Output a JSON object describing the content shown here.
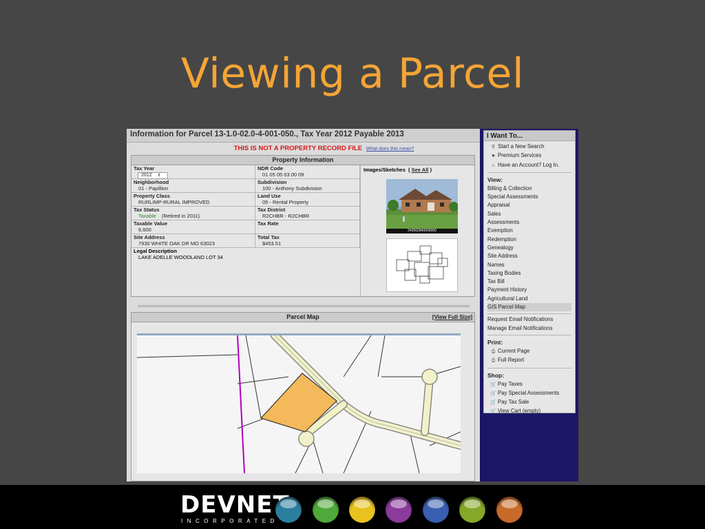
{
  "slide": {
    "title": "Viewing a Parcel"
  },
  "parcel": {
    "header": "Information for Parcel 13-1.0-02.0-4-001-050., Tax Year 2012 Payable 2013",
    "notice": "THIS IS NOT A PROPERTY RECORD FILE",
    "notice_link": "What does this mean?",
    "property_info_title": "Property Information",
    "fields": {
      "tax_year_label": "Tax Year",
      "tax_year_value": "2012",
      "ndr_code_label": "NDR Code",
      "ndr_code_value": "01 05 05 03 00 09",
      "neighborhood_label": "Neighborhood",
      "neighborhood_value": "01 - Papillion",
      "subdivision_label": "Subdivision",
      "subdivision_value": "100 - Anthony Subdivision",
      "property_class_label": "Property Class",
      "property_class_value": "RURLIMP-RURAL IMPROVED",
      "land_use_label": "Land Use",
      "land_use_value": "05 - Rental Property",
      "tax_status_label": "Tax Status",
      "tax_status_value": "Taxable",
      "tax_status_note": "(Retired in 2011)",
      "tax_district_label": "Tax District",
      "tax_district_value": "R2CHBR - R2CHBR",
      "taxable_value_label": "Taxable Value",
      "taxable_value_value": "6,600",
      "tax_rate_label": "Tax Rate",
      "tax_rate_value": "",
      "site_address_label": "Site Address",
      "site_address_value": "7930 WHITE OAK DR MO 63023",
      "total_tax_label": "Total Tax",
      "total_tax_value": "$453.51",
      "legal_description_label": "Legal Description",
      "legal_description_value": "LAKE ADELLE WOODLAND LOT 34"
    },
    "images": {
      "title": "Images/Sketches",
      "see_all": "See All",
      "photo_caption": "240562840000000"
    },
    "map": {
      "title": "Parcel Map",
      "view_full": "[View Full Size]"
    }
  },
  "sidebar": {
    "title": "I Want To...",
    "top": [
      {
        "label": "Start a New Search",
        "icon": "magnifier-icon"
      },
      {
        "label": "Premium Services",
        "icon": "star-icon"
      },
      {
        "label": "Have an Account? Log In.",
        "icon": "house-icon"
      }
    ],
    "view_head": "View:",
    "view": [
      "Billing & Collection",
      "Special Assessments",
      "Appraisal",
      "Sales",
      "Assessments",
      "Exemption",
      "Redemption",
      "Genealogy",
      "Site Address",
      "Names",
      "Taxing Bodies",
      "Tax Bill",
      "Payment History",
      "Agricultural Land",
      "GIS Parcel Map"
    ],
    "notify": [
      "Request Email Notifications",
      "Manage Email Notifications"
    ],
    "print_head": "Print:",
    "print": [
      "Current Page",
      "Full Report"
    ],
    "shop_head": "Shop:",
    "shop": [
      "Pay Taxes",
      "Pay Special Assessments",
      "Pay Tax Sale",
      "View Cart (empty)"
    ]
  },
  "footer": {
    "logo": "DEVNET",
    "logo_sub": "INCORPORATED",
    "orb_colors": [
      "#2a7f9e",
      "#4fa83a",
      "#e8c21e",
      "#8c3a9c",
      "#3a5fb0",
      "#86a828",
      "#c86a2a"
    ]
  }
}
